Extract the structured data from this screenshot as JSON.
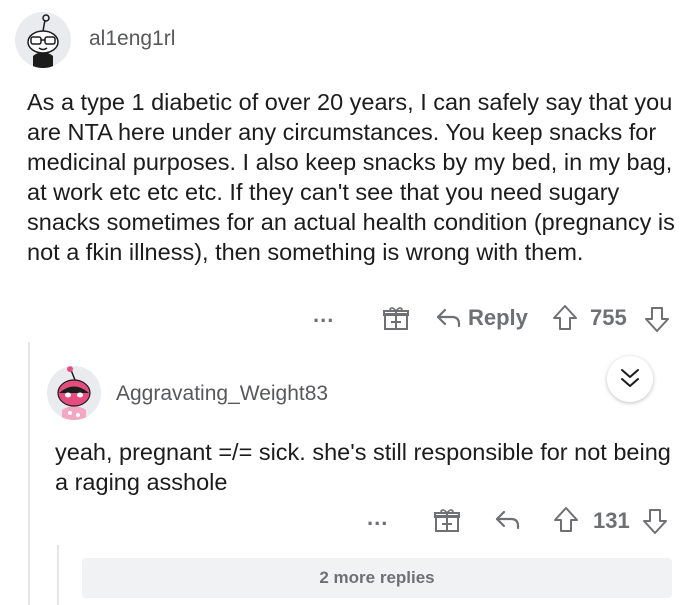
{
  "comments": [
    {
      "username": "al1eng1rl",
      "body": "As a type 1 diabetic of over 20 years, I can safely say that you are NTA here under any circumstances. You keep snacks for medicinal purposes. I also keep snacks by my bed, in my bag, at work etc etc etc. If they can't see that you need sugary snacks sometimes for an actual health condition (pregnancy is not a fkin illness), then something is wrong with them.",
      "more_label": "...",
      "reply_label": "Reply",
      "votes": "755"
    },
    {
      "username": "Aggravating_Weight83",
      "body": "yeah, pregnant =/= sick. she's still responsible for not being a raging asshole",
      "more_label": "...",
      "votes": "131"
    }
  ],
  "more_replies_label": "2 more replies",
  "colors": {
    "text": "#1c1c1d",
    "meta": "#6e7073",
    "thread_line": "#e4e5e7",
    "avatar2_pink": "#e54d7f"
  },
  "icons": [
    "snoo-avatar",
    "gift-icon",
    "reply-arrow-icon",
    "upvote-icon",
    "downvote-icon",
    "chevron-down-icon"
  ]
}
